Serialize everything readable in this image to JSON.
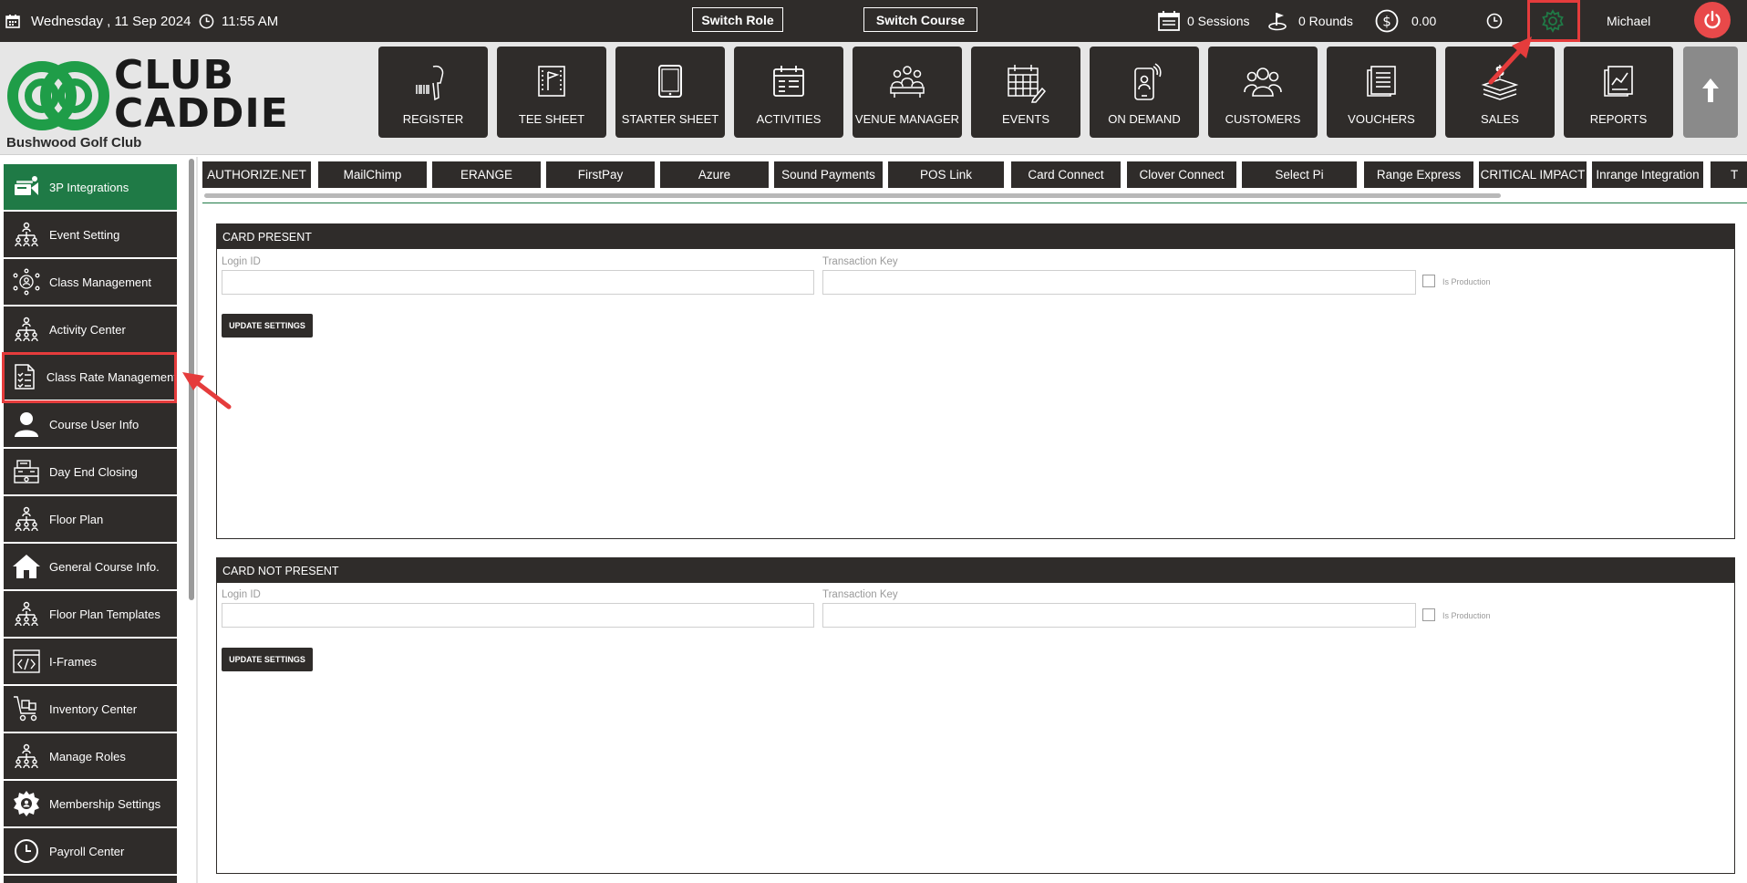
{
  "topbar": {
    "date": "Wednesday ,  11 Sep 2024",
    "time": "11:55 AM",
    "switch_role": "Switch Role",
    "switch_course": "Switch Course",
    "sessions": "0 Sessions",
    "rounds": "0 Rounds",
    "balance": "0.00",
    "user": "Michael"
  },
  "brand": {
    "logo_line1": "CLUB",
    "logo_line2": "CADDIE",
    "club_name": "Bushwood Golf Club"
  },
  "nav": [
    {
      "label": "REGISTER"
    },
    {
      "label": "TEE SHEET"
    },
    {
      "label": "STARTER SHEET"
    },
    {
      "label": "ACTIVITIES"
    },
    {
      "label": "VENUE MANAGER"
    },
    {
      "label": "EVENTS"
    },
    {
      "label": "ON DEMAND"
    },
    {
      "label": "CUSTOMERS"
    },
    {
      "label": "VOUCHERS"
    },
    {
      "label": "SALES"
    },
    {
      "label": "REPORTS"
    }
  ],
  "sidebar": {
    "items": [
      {
        "label": "3P Integrations",
        "icon": "integrations-icon"
      },
      {
        "label": "Event Setting",
        "icon": "org-chart-icon"
      },
      {
        "label": "Class Management",
        "icon": "gear-person-icon"
      },
      {
        "label": "Activity  Center",
        "icon": "org-chart-icon"
      },
      {
        "label": "Class Rate Management",
        "icon": "checklist-icon"
      },
      {
        "label": "Course User Info",
        "icon": "user-icon"
      },
      {
        "label": "Day End Closing",
        "icon": "cash-register-icon"
      },
      {
        "label": "Floor Plan",
        "icon": "org-chart-icon"
      },
      {
        "label": "General Course Info.",
        "icon": "home-icon"
      },
      {
        "label": "Floor Plan Templates",
        "icon": "org-chart-icon"
      },
      {
        "label": "I-Frames",
        "icon": "code-icon"
      },
      {
        "label": "Inventory Center",
        "icon": "cart-icon"
      },
      {
        "label": "Manage Roles",
        "icon": "org-chart-icon"
      },
      {
        "label": "Membership Settings",
        "icon": "gear-icon"
      },
      {
        "label": "Payroll Center",
        "icon": "clock-icon"
      }
    ]
  },
  "integration_tabs": [
    "AUTHORIZE.NET",
    "MailChimp",
    "ERANGE",
    "FirstPay",
    "Azure",
    "Sound Payments",
    "POS Link",
    "Card Connect",
    "Clover Connect",
    "Select Pi",
    "Range Express",
    "CRITICAL IMPACT",
    "Inrange Integration",
    "T"
  ],
  "card_present": {
    "title": "CARD PRESENT",
    "login_label": "Login ID",
    "login_value": "",
    "key_label": "Transaction Key",
    "key_value": "",
    "production_label": "Is Production",
    "button": "UPDATE SETTINGS"
  },
  "card_not_present": {
    "title": "CARD NOT PRESENT",
    "login_label": "Login ID",
    "login_value": "",
    "key_label": "Transaction Key",
    "key_value": "",
    "production_label": "Is Production",
    "button": "UPDATE SETTINGS"
  },
  "colors": {
    "dark": "#2f2c2a",
    "brand_green": "#1f7a46",
    "highlight": "#e53c3c",
    "power": "#e8494a"
  }
}
